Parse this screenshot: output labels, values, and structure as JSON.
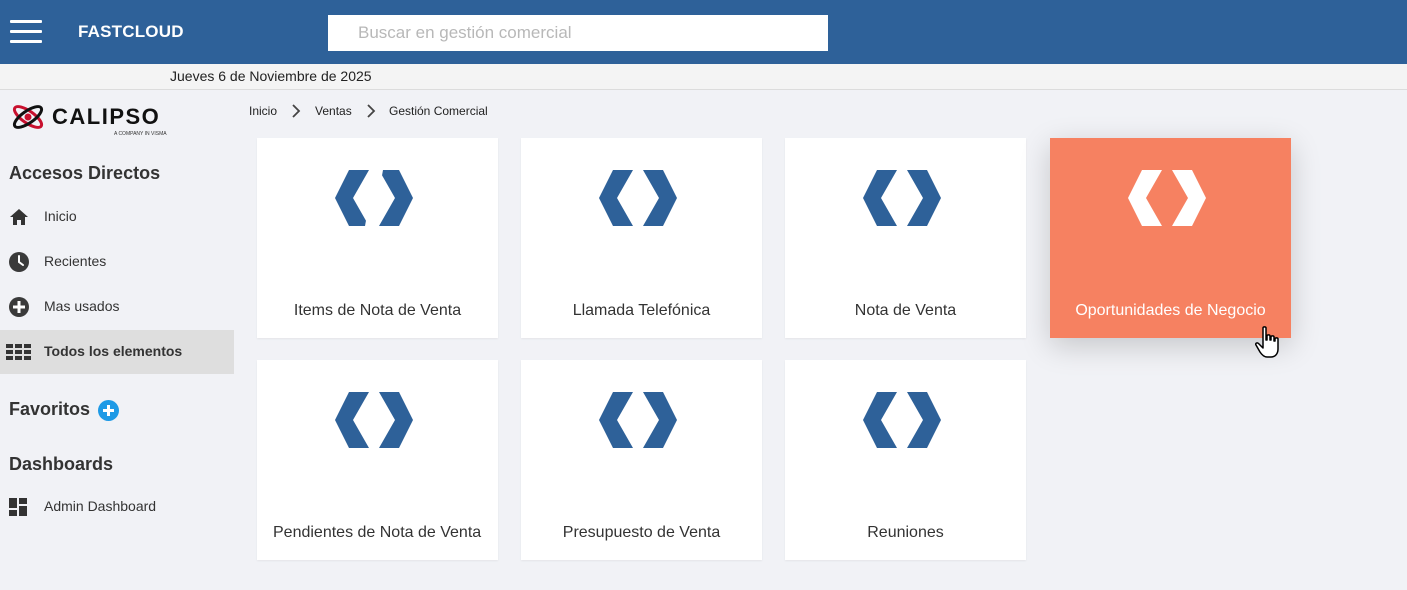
{
  "header": {
    "app_title": "FASTCLOUD",
    "search_placeholder": "Buscar en gestión comercial",
    "search_value": "",
    "color": "#2e6199"
  },
  "date_text": "Jueves 6 de Noviembre de 2025",
  "logo": {
    "name": "CALIPSO",
    "tagline": "A COMPANY IN VISMA"
  },
  "sidebar": {
    "accesos_title": "Accesos Directos",
    "items": [
      {
        "label": "Inicio",
        "icon": "home-icon"
      },
      {
        "label": "Recientes",
        "icon": "clock-icon"
      },
      {
        "label": "Mas usados",
        "icon": "plus-circle-icon"
      },
      {
        "label": "Todos los elementos",
        "icon": "grid-icon",
        "active": true
      }
    ],
    "favoritos_title": "Favoritos",
    "dashboards_title": "Dashboards",
    "dashboards": [
      {
        "label": "Admin Dashboard",
        "icon": "dashboard-icon"
      }
    ]
  },
  "breadcrumb": [
    "Inicio",
    "Ventas",
    "Gestión Comercial"
  ],
  "cards": [
    {
      "label": "Items de Nota de Venta"
    },
    {
      "label": "Llamada Telefónica"
    },
    {
      "label": "Nota de Venta"
    },
    {
      "label": "Oportunidades de Negocio",
      "hovered": true
    },
    {
      "label": "Pendientes de Nota de Venta"
    },
    {
      "label": "Presupuesto de Venta"
    },
    {
      "label": "Reuniones"
    }
  ],
  "colors": {
    "accent": "#1e9ae6",
    "hover_card": "#f68161",
    "icon_blue": "#2e6199"
  }
}
